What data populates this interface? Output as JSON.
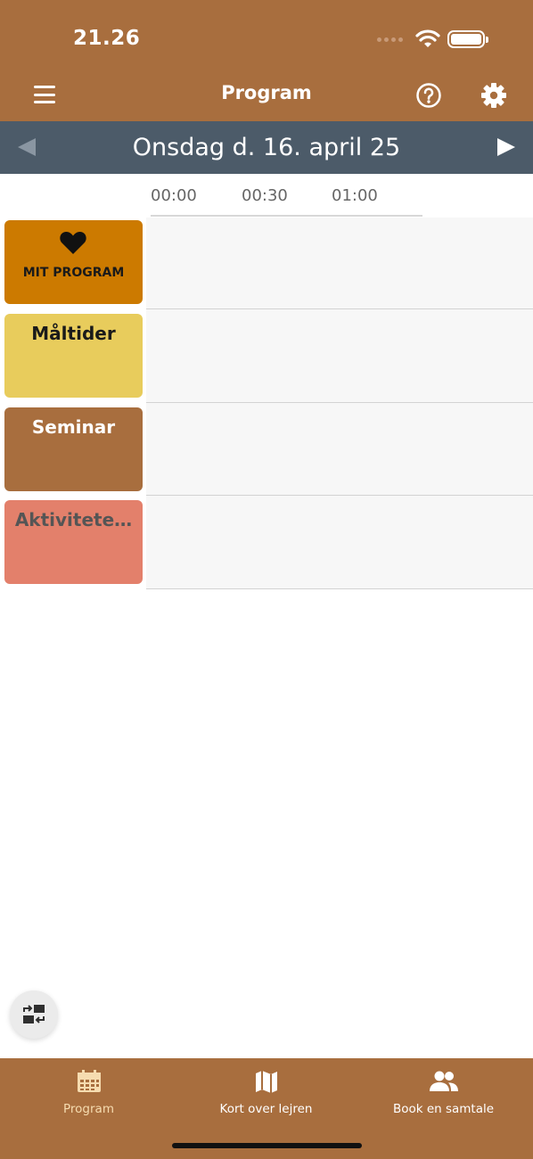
{
  "status_bar": {
    "time": "21.26"
  },
  "header": {
    "title": "Program",
    "menu_icon": "hamburger-menu-icon",
    "help_icon": "help-circle-icon",
    "settings_icon": "gear-icon"
  },
  "date_nav": {
    "date": "Onsdag d. 16. april 25",
    "prev_icon": "triangle-left-icon",
    "next_icon": "triangle-right-icon"
  },
  "timeline": {
    "times": [
      "00:00",
      "00:30",
      "01:00"
    ]
  },
  "categories": [
    {
      "label": "MIT PROGRAM",
      "icon": "heart-icon",
      "color": "#cc7a00"
    },
    {
      "label": "Måltider",
      "color": "#e8cc5c"
    },
    {
      "label": "Seminar",
      "color": "#a86e3e"
    },
    {
      "label": "Aktivitete…",
      "color": "#e3806b"
    }
  ],
  "fab": {
    "icon": "switch-view-icon"
  },
  "tabs": [
    {
      "label": "Program",
      "icon": "calendar-icon",
      "active": true
    },
    {
      "label": "Kort over lejren",
      "icon": "map-icon",
      "active": false
    },
    {
      "label": "Book en samtale",
      "icon": "people-icon",
      "active": false
    }
  ],
  "colors": {
    "brand": "#a86e3e",
    "date_bar": "#4c5b69",
    "active_tab": "#f6dcb0"
  }
}
